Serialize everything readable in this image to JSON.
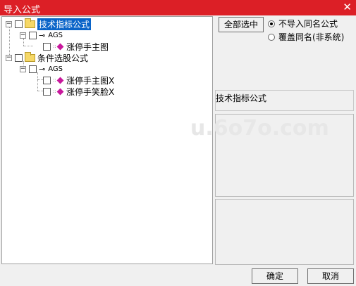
{
  "window": {
    "title": "导入公式",
    "close_glyph": "✕"
  },
  "tree": {
    "root1": {
      "label": "技术指标公式",
      "toggle": "−"
    },
    "ags1": {
      "label": "AGS",
      "toggle": "−"
    },
    "leaf1": {
      "label": "涨停手主图"
    },
    "root2": {
      "label": "条件选股公式",
      "toggle": "−"
    },
    "ags2": {
      "label": "AGS",
      "toggle": "−"
    },
    "leaf2": {
      "label": "涨停手主图X"
    },
    "leaf3": {
      "label": "涨停手笑脸X"
    }
  },
  "options": {
    "select_all": "全部选中",
    "radio_no_import": "不导入同名公式",
    "radio_overwrite": "覆盖同名(非系统)",
    "selected": "不导入同名公式"
  },
  "info": {
    "category_label": "技术指标公式"
  },
  "footer": {
    "ok": "确定",
    "cancel": "取消"
  },
  "watermark": {
    "text": "u.6o7o.com"
  }
}
